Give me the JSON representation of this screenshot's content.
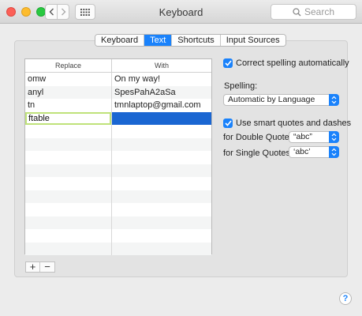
{
  "window": {
    "title": "Keyboard",
    "search_placeholder": "Search"
  },
  "tabs": [
    {
      "label": "Keyboard",
      "active": false
    },
    {
      "label": "Text",
      "active": true
    },
    {
      "label": "Shortcuts",
      "active": false
    },
    {
      "label": "Input Sources",
      "active": false
    }
  ],
  "table": {
    "headers": {
      "replace": "Replace",
      "with": "With"
    },
    "rows": [
      {
        "replace": "omw",
        "with": "On my way!"
      },
      {
        "replace": "anyl",
        "with": "SpesPahA2aSa"
      },
      {
        "replace": "tn",
        "with": "tmnlaptop@gmail.com"
      },
      {
        "replace": "ftable",
        "with": ""
      }
    ],
    "editing_value": "ftable",
    "add_label": "+",
    "remove_label": "−"
  },
  "options": {
    "correct_spelling": {
      "label": "Correct spelling automatically",
      "checked": true
    },
    "spelling_label": "Spelling:",
    "spelling_value": "Automatic by Language",
    "smart_quotes": {
      "label": "Use smart quotes and dashes",
      "checked": true
    },
    "double_quotes_label": "for Double Quotes",
    "double_quotes_value": "“abc”",
    "single_quotes_label": "for Single Quotes",
    "single_quotes_value": "‘abc’"
  },
  "help_label": "?",
  "colors": {
    "accent": "#1a82fb",
    "selection": "#1a66d2",
    "edit_border": "#bfe27a"
  }
}
